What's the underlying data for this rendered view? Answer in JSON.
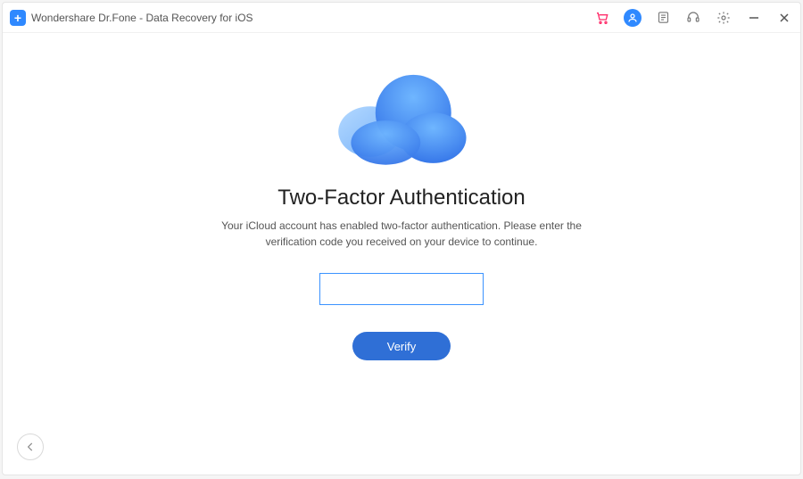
{
  "app": {
    "title": "Wondershare Dr.Fone - Data Recovery for iOS"
  },
  "titlebar": {
    "icons": {
      "cart": "cart-icon",
      "user": "user-icon",
      "feedback": "feedback-icon",
      "support": "support-icon",
      "settings": "gear-icon",
      "minimize": "minimize-icon",
      "close": "close-icon"
    }
  },
  "main": {
    "heading": "Two-Factor Authentication",
    "subtext": "Your iCloud account has enabled two-factor authentication. Please enter the verification code you received on your device to continue.",
    "code_value": "",
    "code_placeholder": "",
    "verify_label": "Verify"
  },
  "footer": {
    "back_icon": "arrow-left-icon"
  },
  "colors": {
    "accent": "#2f89ff",
    "button": "#2f6fd6",
    "cart": "#ff2d6b"
  }
}
